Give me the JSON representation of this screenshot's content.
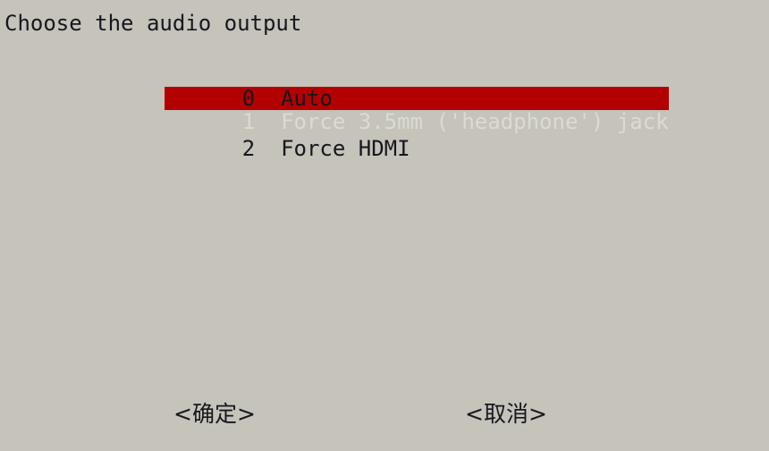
{
  "screen": {
    "background_color": "#c5c3ba",
    "text_color": "#17171f",
    "highlight_color": "#b30000",
    "highlight_text_color": "#dcdbd2"
  },
  "dialog": {
    "prompt": "Choose the audio output",
    "menu": {
      "selected_index": 1,
      "items": [
        {
          "index": "0",
          "gap": "  ",
          "label": "Auto"
        },
        {
          "index": "1",
          "gap": "  ",
          "label": "Force 3.5mm ('headphone') jack"
        },
        {
          "index": "2",
          "gap": "  ",
          "label": "Force HDMI"
        }
      ]
    },
    "buttons": {
      "ok": "<确定>",
      "cancel": "<取消>"
    }
  }
}
